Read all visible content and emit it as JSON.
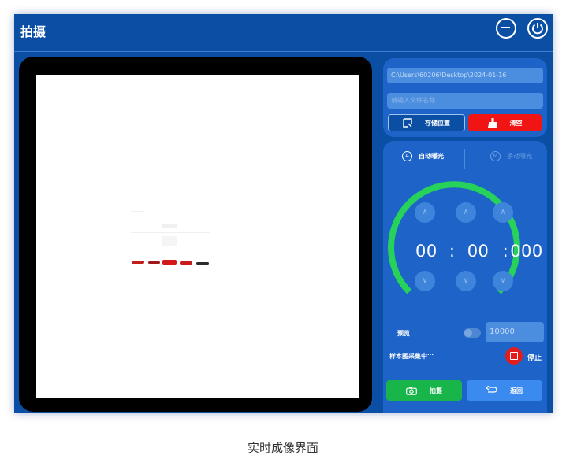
{
  "window": {
    "title": "拍摄"
  },
  "storage": {
    "path_value": "C:\\Users\\60206\\Desktop\\2024-01-16",
    "name_placeholder": "请输入文件名称",
    "save_location_label": "存储位置",
    "clear_label": "清空"
  },
  "exposure": {
    "auto_label": "自动曝光",
    "manual_label": "手动曝光",
    "time": {
      "minutes": "00",
      "seconds": "00",
      "millis": "000",
      "sep1": ":",
      "sep2": ":"
    },
    "arrow_glyph": "∧",
    "arrow_down_glyph": "∨"
  },
  "preview": {
    "label": "预览",
    "value": "10000"
  },
  "sampling": {
    "status": "样本图采集中",
    "dots": "···",
    "stop_label": "停止"
  },
  "actions": {
    "capture_label": "拍摄",
    "back_label": "返回"
  },
  "caption": "实时成像界面",
  "colors": {
    "accent": "#0b4fa5",
    "ring": "#27d25a",
    "clear": "#f01414",
    "capture": "#17b54a"
  }
}
